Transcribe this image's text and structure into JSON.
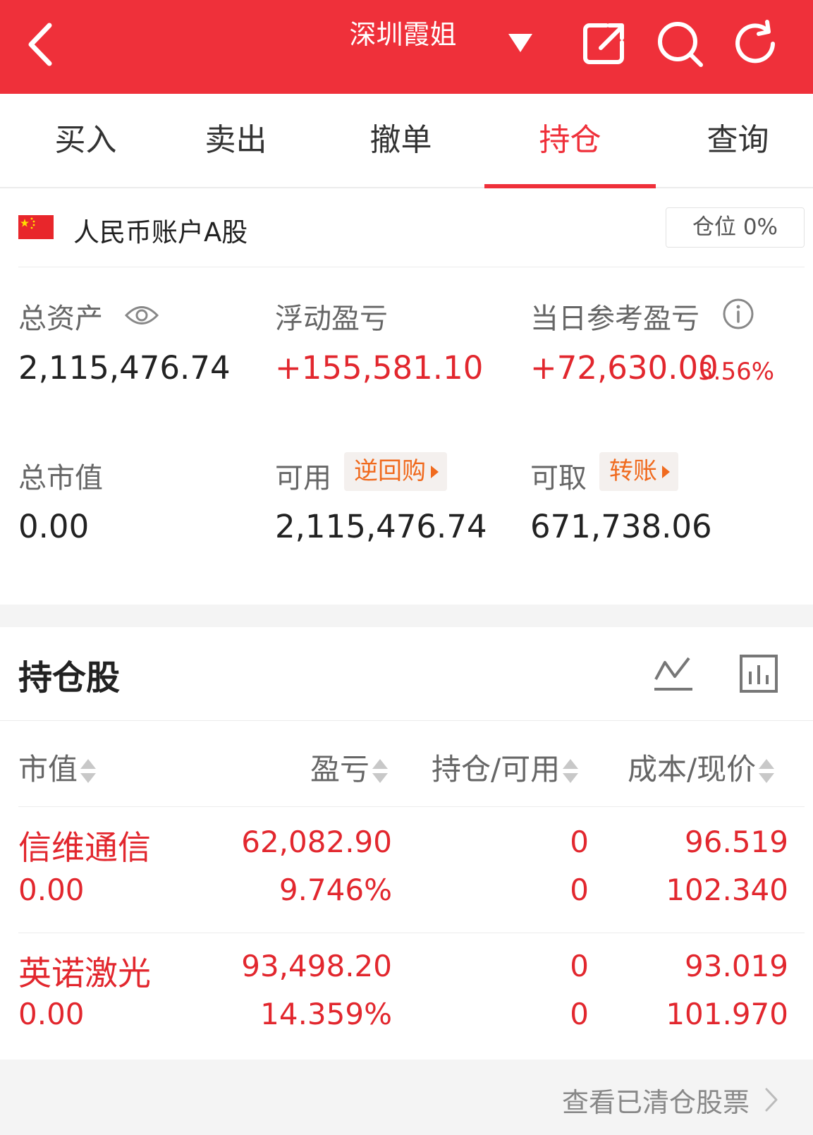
{
  "header": {
    "title": "深圳霞姐"
  },
  "icons": {
    "back": "back-arrow-icon",
    "dropdown": "caret-down-icon",
    "share": "share-icon",
    "search": "search-icon",
    "refresh": "refresh-icon",
    "eye": "eye-icon",
    "info": "info-icon",
    "trend": "trend-chart-icon",
    "bar": "bar-chart-icon",
    "flag": "china-flag-icon"
  },
  "colors": {
    "brand": "#ef303a",
    "profit": "#e2272e",
    "chip_text": "#f06a1e"
  },
  "tabs": [
    {
      "label": "买入"
    },
    {
      "label": "卖出"
    },
    {
      "label": "撤单"
    },
    {
      "label": "持仓",
      "active": true
    },
    {
      "label": "查询"
    }
  ],
  "account": {
    "name": "人民币账户A股",
    "position_ratio": "仓位 0%",
    "total_assets_label": "总资产",
    "total_assets": "2,115,476.74",
    "float_pl_label": "浮动盈亏",
    "float_pl": "+155,581.10",
    "daily_pl_label": "当日参考盈亏",
    "daily_pl": "+72,630.00",
    "daily_pl_pct": "3.56%",
    "market_value_label": "总市值",
    "market_value": "0.00",
    "available_label": "可用",
    "available": "2,115,476.74",
    "reverse_repo": "逆回购",
    "withdrawable_label": "可取",
    "withdrawable": "671,738.06",
    "transfer": "转账"
  },
  "holdings": {
    "title": "持仓股",
    "columns": [
      "市值",
      "盈亏",
      "持仓/可用",
      "成本/现价"
    ],
    "rows": [
      {
        "name": "信维通信",
        "market_value": "0.00",
        "pl": "62,082.90",
        "pl_pct": "9.746%",
        "position": "0",
        "available": "0",
        "cost": "96.519",
        "price": "102.340"
      },
      {
        "name": "英诺激光",
        "market_value": "0.00",
        "pl": "93,498.20",
        "pl_pct": "14.359%",
        "position": "0",
        "available": "0",
        "cost": "93.019",
        "price": "101.970"
      }
    ]
  },
  "footer": {
    "link": "查看已清仓股票"
  }
}
